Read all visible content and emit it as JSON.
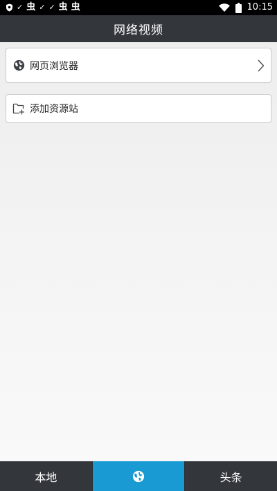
{
  "status_bar": {
    "time": "10:15",
    "notification_icons": [
      "shield-icon",
      "check-icon",
      "bug-icon",
      "check-icon",
      "check-icon",
      "bug-icon",
      "bug-icon"
    ],
    "check_glyph": "✓",
    "bug_glyph": "虫"
  },
  "header": {
    "title": "网络视频"
  },
  "main": {
    "items": [
      {
        "label": "网页浏览器",
        "icon": "globe-icon",
        "has_chevron": true
      },
      {
        "label": "添加资源站",
        "icon": "add-folder-icon",
        "has_chevron": false
      }
    ]
  },
  "bottom_nav": {
    "tabs": [
      {
        "label": "本地",
        "active": false
      },
      {
        "label": "",
        "icon": "globe-icon",
        "active": true
      },
      {
        "label": "头条",
        "active": false
      }
    ]
  },
  "colors": {
    "header_bg": "#33363b",
    "active_tab": "#1a9ad2",
    "status_bar_bg": "#000000",
    "card_border": "#c9c9c9"
  }
}
